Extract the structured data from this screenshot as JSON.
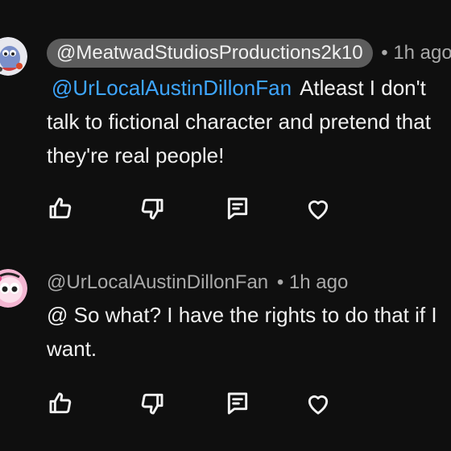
{
  "comments": [
    {
      "author": "@MeatwadStudiosProductions2k10",
      "time": "• 1h ago",
      "mention": "@UrLocalAustinDillonFan",
      "lines": [
        "Atleast I don't",
        "talk to fictional character and pretend that",
        "they're real people!"
      ]
    },
    {
      "author": "@UrLocalAustinDillonFan",
      "time": "• 1h ago",
      "lines": [
        "@ So what? I have the rights to do that if I",
        "want."
      ]
    }
  ],
  "icons": {
    "like": "thumbs-up-icon",
    "dislike": "thumbs-down-icon",
    "reply": "reply-icon",
    "heart": "heart-icon"
  },
  "colors": {
    "background": "#0f0f0f",
    "mention": "#3ea6ff",
    "pill": "#5c5c5c",
    "meta": "#aaaaaa"
  }
}
